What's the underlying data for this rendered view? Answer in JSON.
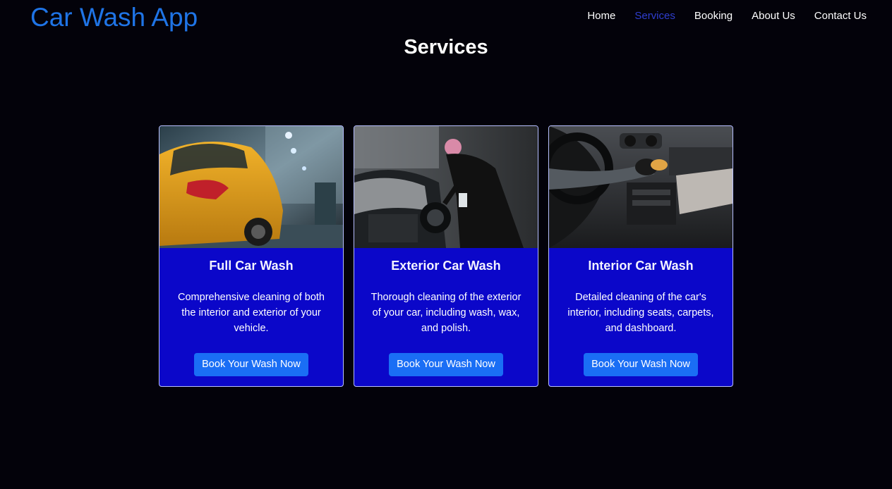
{
  "header": {
    "brand": "Car Wash App",
    "nav": [
      {
        "label": "Home",
        "active": false
      },
      {
        "label": "Services",
        "active": true
      },
      {
        "label": "Booking",
        "active": false
      },
      {
        "label": "About Us",
        "active": false
      },
      {
        "label": "Contact Us",
        "active": false
      }
    ]
  },
  "main": {
    "title": "Services",
    "services": [
      {
        "title": "Full Car Wash",
        "description": "Comprehensive cleaning of both the interior and exterior of your vehicle.",
        "button_label": "Book Your Wash Now",
        "image": "yellow-car-wash-photo"
      },
      {
        "title": "Exterior Car Wash",
        "description": "Thorough cleaning of the exterior of your car, including wash, wax, and polish.",
        "button_label": "Book Your Wash Now",
        "image": "exterior-polish-photo"
      },
      {
        "title": "Interior Car Wash",
        "description": "Detailed cleaning of the car's interior, including seats, carpets, and dashboard.",
        "button_label": "Book Your Wash Now",
        "image": "interior-dashboard-photo"
      }
    ]
  },
  "colors": {
    "background": "#03020a",
    "brand": "#1f74e6",
    "nav_active": "#2f3ecf",
    "card": "#0b07c9",
    "button": "#1a6ef5"
  }
}
